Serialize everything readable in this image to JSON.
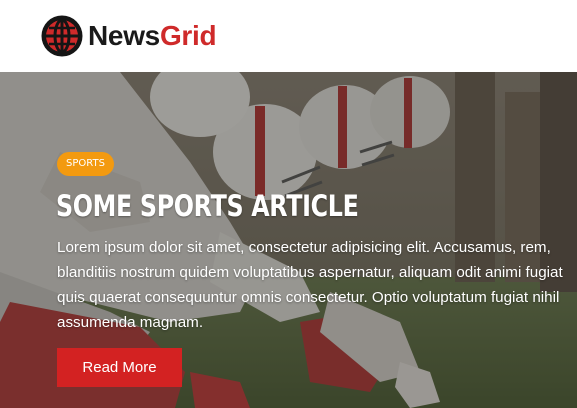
{
  "brand": {
    "name_part1": "News",
    "name_part2": "Grid",
    "logo_icon": "globe-icon",
    "colors": {
      "dark": "#1a1a1a",
      "accent": "#cf2a2a"
    }
  },
  "hero": {
    "background_image": "american-football-players-photo",
    "category_badge": "SPORTS",
    "title": "Some Sports Article",
    "body": "Lorem ipsum dolor sit amet, consectetur adipisicing elit. Accusamus, rem, blanditiis nostrum quidem voluptatibus aspernatur, aliquam odit animi fugiat quis quaerat consequuntur omnis consectetur. Optio voluptatum fugiat nihil assumenda magnam.",
    "button_label": "Read More",
    "colors": {
      "badge": "#f39a10",
      "button": "#d32222"
    }
  }
}
